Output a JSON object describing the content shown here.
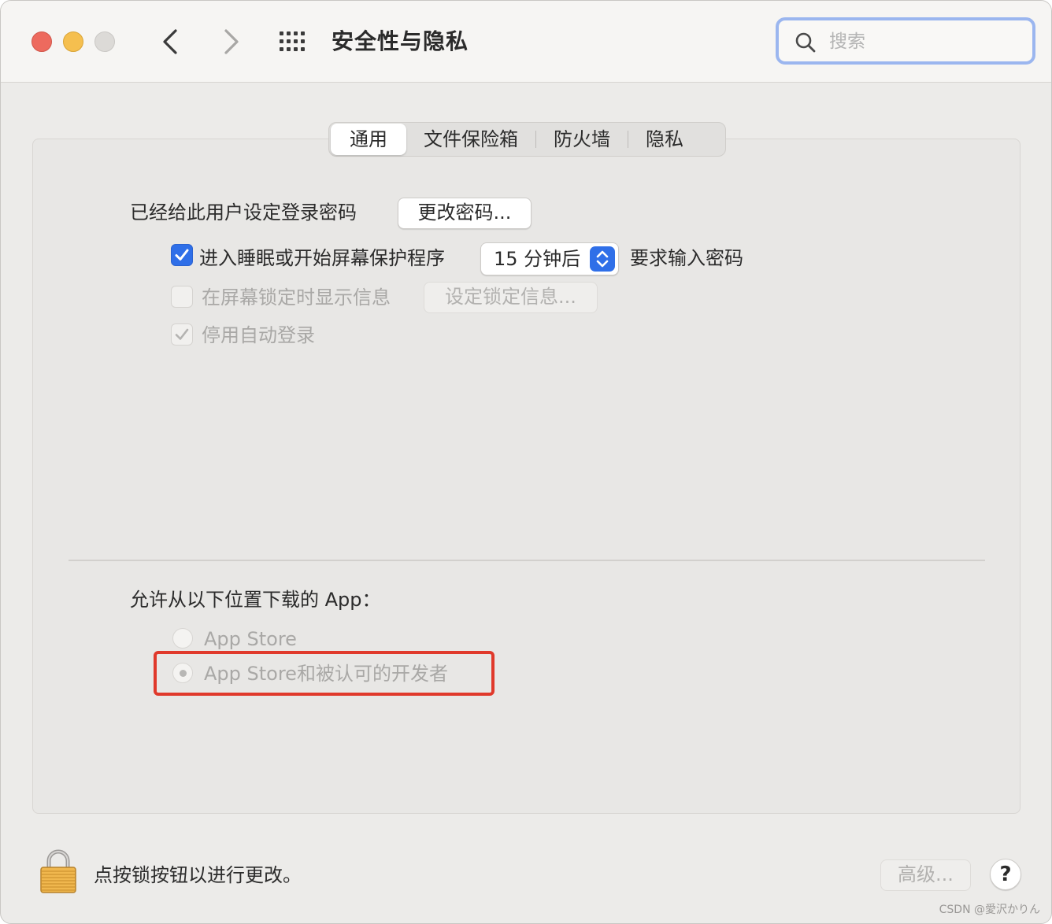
{
  "window": {
    "title": "安全性与隐私",
    "search_placeholder": "搜索"
  },
  "tabs": [
    {
      "label": "通用",
      "active": true
    },
    {
      "label": "文件保险箱",
      "active": false
    },
    {
      "label": "防火墙",
      "active": false
    },
    {
      "label": "隐私",
      "active": false
    }
  ],
  "general": {
    "password_set_label": "已经给此用户设定登录密码",
    "change_password_button": "更改密码...",
    "require_password": {
      "checked": true,
      "label": "进入睡眠或开始屏幕保护程序",
      "delay_value": "15 分钟后",
      "suffix": "要求输入密码"
    },
    "lock_message": {
      "checked": false,
      "enabled": false,
      "label": "在屏幕锁定时显示信息",
      "button": "设定锁定信息..."
    },
    "disable_auto_login": {
      "checked": true,
      "enabled": false,
      "label": "停用自动登录"
    }
  },
  "allow_apps": {
    "heading": "允许从以下位置下载的 App：",
    "options": [
      {
        "label": "App Store",
        "selected": false
      },
      {
        "label": "App Store和被认可的开发者",
        "selected": true
      }
    ]
  },
  "footer": {
    "lock_text": "点按锁按钮以进行更改。",
    "advanced_button": "高级...",
    "help_button": "?"
  },
  "watermark": "CSDN @愛沢かりん",
  "colors": {
    "accent": "#2f6fe8",
    "highlight_box": "#e0392b",
    "search_focus": "#9bb6ef"
  }
}
